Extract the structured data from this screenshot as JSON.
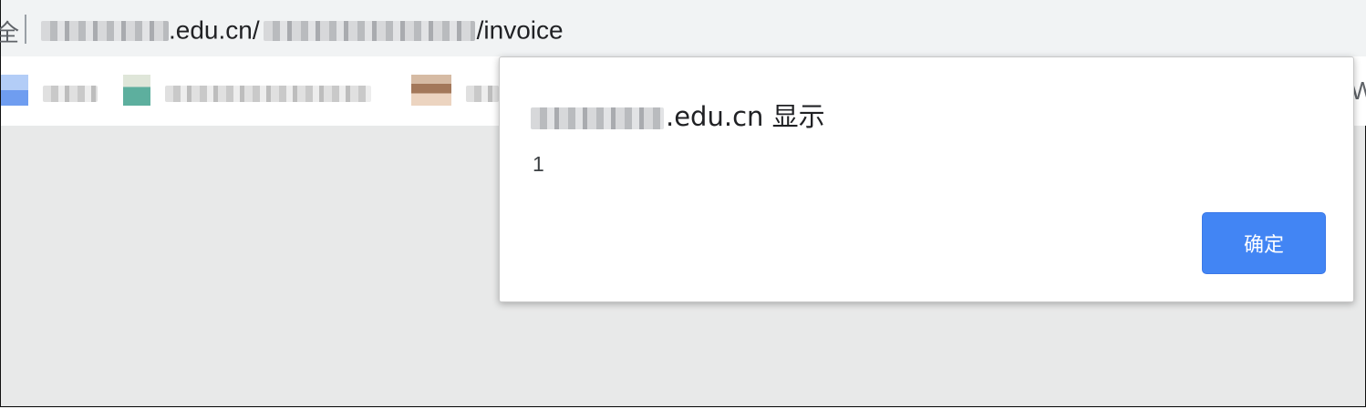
{
  "address_bar": {
    "security_label": "全",
    "url_domain_suffix": ".edu.cn/",
    "url_path_suffix": "/invoice"
  },
  "dialog": {
    "title_suffix": ".edu.cn 显示",
    "message": "1",
    "ok_label": "确定"
  },
  "bookmarks_bar": {
    "overflow_glyph": "W"
  },
  "colors": {
    "button_blue": "#4285f4",
    "page_background": "#e8e9e9",
    "omnibox_background": "#f1f3f4"
  }
}
